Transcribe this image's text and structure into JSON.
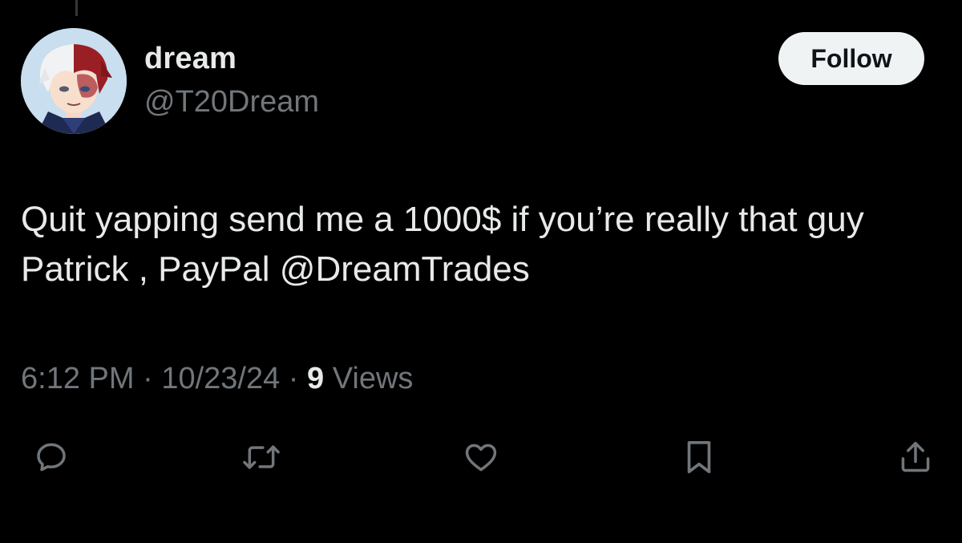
{
  "author": {
    "display_name": "dream",
    "handle": "@T20Dream"
  },
  "follow_label": "Follow",
  "tweet": {
    "text": "Quit yapping send me a 1000$ if you’re really that guy Patrick , PayPal @DreamTrades",
    "time": "6:12 PM",
    "separator": "·",
    "date": "10/23/24",
    "views_count": "9",
    "views_label": "Views"
  },
  "actions": [
    {
      "name": "reply",
      "icon": "reply-icon"
    },
    {
      "name": "retweet",
      "icon": "retweet-icon"
    },
    {
      "name": "like",
      "icon": "heart-icon"
    },
    {
      "name": "bookmark",
      "icon": "bookmark-icon"
    },
    {
      "name": "share",
      "icon": "share-icon"
    }
  ],
  "colors": {
    "background": "#000000",
    "primary_text": "#e7e9ea",
    "secondary_text": "#71767b",
    "follow_bg": "#eff3f4",
    "follow_text": "#0f1419"
  }
}
